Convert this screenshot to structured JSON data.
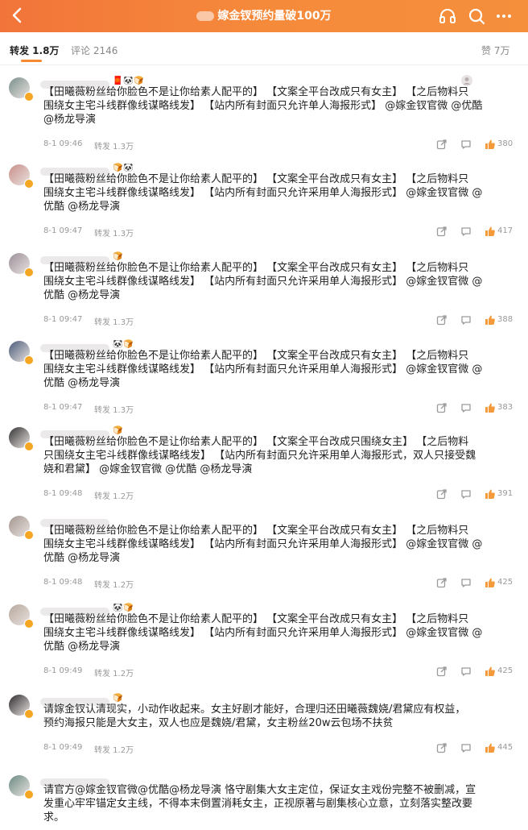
{
  "header": {
    "back_icon": "chevron-left-icon",
    "title": "嫁金钗预约量破100万",
    "icons": [
      "headset-icon",
      "search-icon",
      "more-icon"
    ],
    "gradient_colors": [
      "#f2743a",
      "#f58f3c"
    ]
  },
  "tabs": {
    "forward": "转发 1.8万",
    "comments": "评论 2146",
    "likes": "赞 7万",
    "accent": "#f6892f"
  },
  "comments": [
    {
      "lines": [
        "【田曦薇粉丝给你脸色不是让你给素人配平的】 【文案全平台改成只有女主】 【之后物料只",
        "围绕女主宅斗线群像线谋略线发】 【站内所有封面只允许单人海报形式】 @嫁金钗官微 @优酷",
        "@杨龙导演"
      ],
      "time": "8-1 09:46",
      "reposts": "转发 1.3万",
      "likes": "380"
    },
    {
      "lines": [
        "【田曦薇粉丝给你脸色不是让你给素人配平的】 【文案全平台改成只有女主】 【之后物料只",
        "围绕女主宅斗线群像线谋略线发】 【站内所有封面只允许采用单人海报形式】 @嫁金钗官微 @",
        "优酷 @杨龙导演"
      ],
      "time": "8-1 09:47",
      "reposts": "转发 1.3万",
      "likes": "417"
    },
    {
      "lines": [
        "【田曦薇粉丝给你脸色不是让你给素人配平的】 【文案全平台改成只有女主】 【之后物料只",
        "围绕女主宅斗线群像线谋略线发】 【站内所有封面只允许采用单人海报形式】 @嫁金钗官微 @",
        "优酷 @杨龙导演"
      ],
      "time": "8-1 09:47",
      "reposts": "转发 1.3万",
      "likes": "388"
    },
    {
      "lines": [
        "【田曦薇粉丝给你脸色不是让你给素人配平的】 【文案全平台改成只有女主】 【之后物料只",
        "围绕女主宅斗线群像线谋略线发】 【站内所有封面只允许采用单人海报形式】 @嫁金钗官微 @",
        "优酷 @杨龙导演"
      ],
      "time": "8-1 09:47",
      "reposts": "转发 1.3万",
      "likes": "383"
    },
    {
      "lines": [
        "【田曦薇粉丝给你脸色不是让你给素人配平的】 【文案全平台改成只围绕女主】 【之后物料",
        "只围绕女主宅斗线群像线谋略线发】 【站内所有封面只允许采用单人海报形式，双人只接受魏",
        "娆和君黛】 @嫁金钗官微 @优酷 @杨龙导演"
      ],
      "time": "8-1 09:48",
      "reposts": "转发 1.2万",
      "likes": "391"
    },
    {
      "lines": [
        "【田曦薇粉丝给你脸色不是让你给素人配平的】 【文案全平台改成只有女主】 【之后物料只",
        "围绕女主宅斗线群像线谋略线发】 【站内所有封面只允许采用单人海报形式】 @嫁金钗官微 @",
        "优酷 @杨龙导演"
      ],
      "time": "8-1 09:48",
      "reposts": "转发 1.2万",
      "likes": "425"
    },
    {
      "lines": [
        "【田曦薇粉丝给你脸色不是让你给素人配平的】 【文案全平台改成只有女主】 【之后物料只",
        "围绕女主宅斗线群像线谋略线发】 【站内所有封面只允许采用单人海报形式】 @嫁金钗官微 @",
        "优酷 @杨龙导演"
      ],
      "time": "8-1 09:49",
      "reposts": "转发 1.2万",
      "likes": "425"
    },
    {
      "lines": [
        "请嫁金钗认清现实，小动作收起来。女主好剧才能好，合理归还田曦薇魏娆/君黛应有权益，",
        "预约海报只能是大女主，双人也应是魏娆/君黛，女主粉丝20w云包场不扶贫"
      ],
      "time": "8-1 09:49",
      "reposts": "转发 1.2万",
      "likes": "445"
    },
    {
      "lines": [
        "请官方@嫁金钗官微@优酷@杨龙导演 恪守剧集大女主定位，保证女主戏份完整不被删减，宣",
        "发重心牢牢锚定女主线，不得本末倒置消耗女主，正视原著与剧集核心立意，立刻落实整改要",
        "求。"
      ],
      "time": "",
      "reposts": "",
      "likes": ""
    }
  ],
  "action_icons": [
    "share-icon",
    "comment-icon",
    "thumbs-up-icon"
  ]
}
